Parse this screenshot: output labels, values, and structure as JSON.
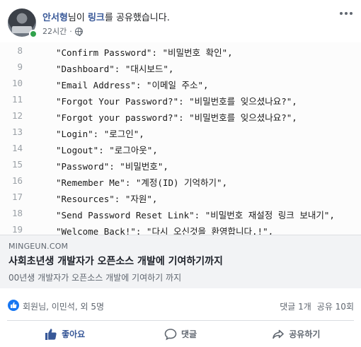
{
  "header": {
    "author": "안서형",
    "action_pre": "님이 ",
    "link_word": "링크",
    "action_post": "를 공유했습니다.",
    "time": "22시간",
    "privacy_icon": "globe-icon",
    "more_icon": "more-icon"
  },
  "code_lines": [
    {
      "num": "8",
      "text": "\"Confirm Password\": \"비밀번호 확인\","
    },
    {
      "num": "9",
      "text": "\"Dashboard\": \"대시보드\","
    },
    {
      "num": "10",
      "text": "\"Email Address\": \"이메일 주소\","
    },
    {
      "num": "11",
      "text": "\"Forgot Your Password?\": \"비밀번호를 잊으셨나요?\","
    },
    {
      "num": "12",
      "text": "\"Forgot your password?\": \"비밀번호를 잊으셨나요?\","
    },
    {
      "num": "13",
      "text": "\"Login\": \"로그인\","
    },
    {
      "num": "14",
      "text": "\"Logout\": \"로그아웃\","
    },
    {
      "num": "15",
      "text": "\"Password\": \"비밀번호\","
    },
    {
      "num": "16",
      "text": "\"Remember Me\": \"계정(ID) 기억하기\","
    },
    {
      "num": "17",
      "text": "\"Resources\": \"자원\","
    },
    {
      "num": "18",
      "text": "\"Send Password Reset Link\": \"비밀번호 재설정 링크 보내기\","
    },
    {
      "num": "19",
      "text": "\"Welcome Back!\": \"다시 오신것을 환영합니다.!\","
    }
  ],
  "preview": {
    "domain": "MINGEUN.COM",
    "title": "사회초년생 개발자가 오픈소스 개발에 기여하기까지",
    "description": "00년생 개발자가 오픈소스 개발에 기여하기 까지"
  },
  "stats": {
    "reactors": "회원님, 이민석, 외 5명",
    "comments": "댓글 1개",
    "shares": "공유 10회"
  },
  "actions": {
    "like": "좋아요",
    "comment": "댓글",
    "share": "공유하기"
  },
  "colors": {
    "link_blue": "#385898",
    "like_blue": "#1877f2",
    "online_green": "#31a24c",
    "muted": "#606770"
  }
}
